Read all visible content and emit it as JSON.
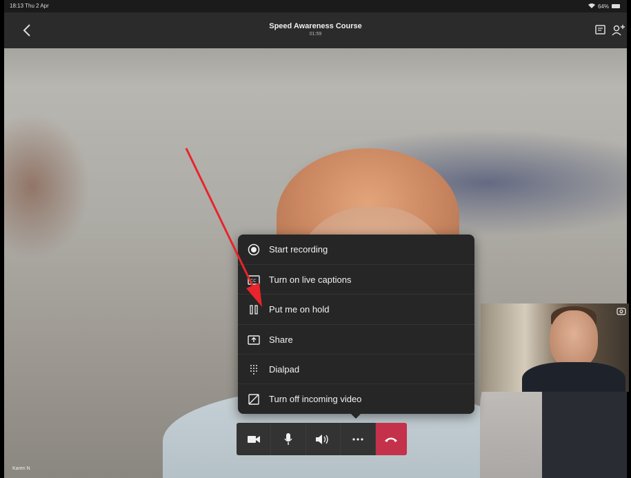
{
  "status_bar": {
    "time": "18:13",
    "date": "Thu 2 Apr",
    "battery": "64%"
  },
  "header": {
    "title": "Speed Awareness Course",
    "timer": "01:59"
  },
  "menu": {
    "items": [
      {
        "label": "Start recording",
        "icon": "record-icon"
      },
      {
        "label": "Turn on live captions",
        "icon": "captions-icon"
      },
      {
        "label": "Put me on hold",
        "icon": "hold-icon"
      },
      {
        "label": "Share",
        "icon": "share-icon"
      },
      {
        "label": "Dialpad",
        "icon": "dialpad-icon"
      },
      {
        "label": "Turn off incoming video",
        "icon": "video-off-icon"
      }
    ]
  },
  "controls": {
    "items": [
      "camera",
      "microphone",
      "speaker",
      "more",
      "hang-up"
    ]
  },
  "participant": {
    "name": "Karen N"
  },
  "colors": {
    "accent_hangup": "#c4314b",
    "annotation": "#e8242c",
    "menu_bg": "#262626"
  }
}
